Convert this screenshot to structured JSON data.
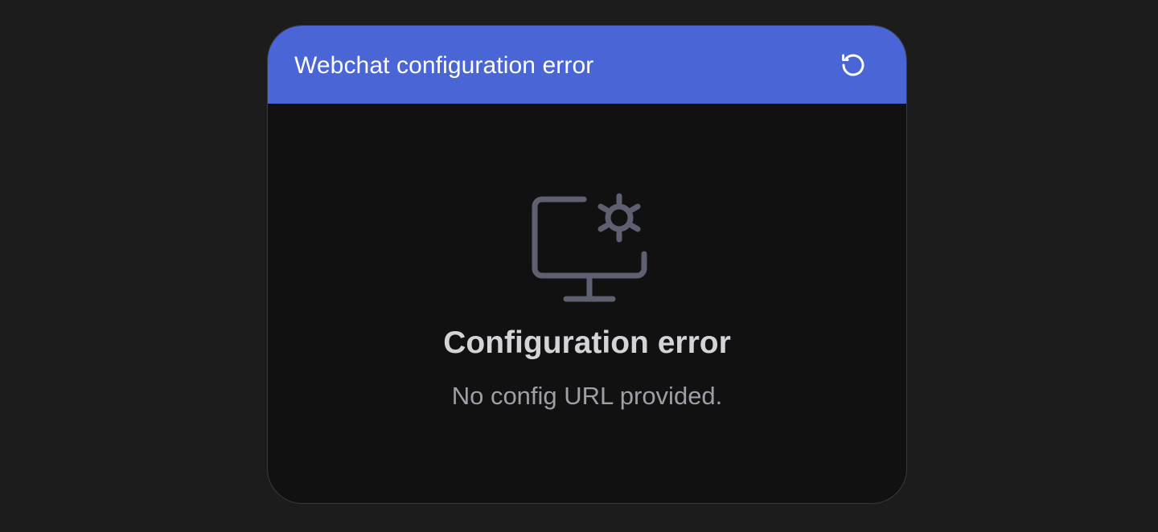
{
  "header": {
    "title": "Webchat configuration error",
    "reload_icon": "refresh-icon"
  },
  "error": {
    "icon": "monitor-settings-icon",
    "title": "Configuration error",
    "message": "No config URL provided."
  },
  "colors": {
    "page_background": "#1c1c1c",
    "header_background": "#4a65d6",
    "panel_background": "#111112",
    "icon_color": "#5f5f72",
    "title_color": "#d4d4d8",
    "message_color": "#9e9ea6"
  }
}
